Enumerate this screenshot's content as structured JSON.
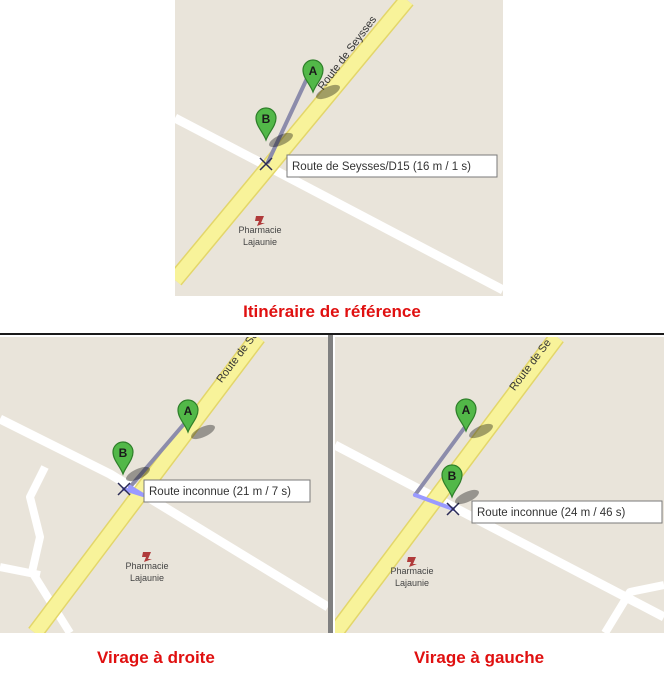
{
  "colors": {
    "land": "#e9e4da",
    "minor_road": "#ffffff",
    "main_road": "#f8f39a",
    "main_road_casing": "#e3d66a",
    "route": "#8c8cab",
    "deviation": "#9a9aff",
    "marker": "#52b848",
    "marker_dark": "#2f7f2a",
    "caption": "#e01010",
    "divider": "#808080"
  },
  "panels": {
    "reference": {
      "caption": "Itinéraire de référence",
      "road_name": "Route de Seysses",
      "tooltip": "Route de Seysses/D15 (16 m / 1 s)",
      "poi": "Pharmacie\nLajaunie",
      "marker_a": "A",
      "marker_b": "B",
      "poi_icon": "pharmacy-icon",
      "marker_icon": "map-pin-icon"
    },
    "right_turn": {
      "caption": "Virage à droite",
      "road_name": "Route de Se",
      "tooltip": "Route inconnue (21 m / 7 s)",
      "poi": "Pharmacie\nLajaunie",
      "marker_a": "A",
      "marker_b": "B",
      "poi_icon": "pharmacy-icon",
      "marker_icon": "map-pin-icon"
    },
    "left_turn": {
      "caption": "Virage à gauche",
      "road_name": "Route de Se",
      "tooltip": "Route inconnue (24 m / 46 s)",
      "poi": "Pharmacie\nLajaunie",
      "marker_a": "A",
      "marker_b": "B",
      "poi_icon": "pharmacy-icon",
      "marker_icon": "map-pin-icon"
    }
  }
}
